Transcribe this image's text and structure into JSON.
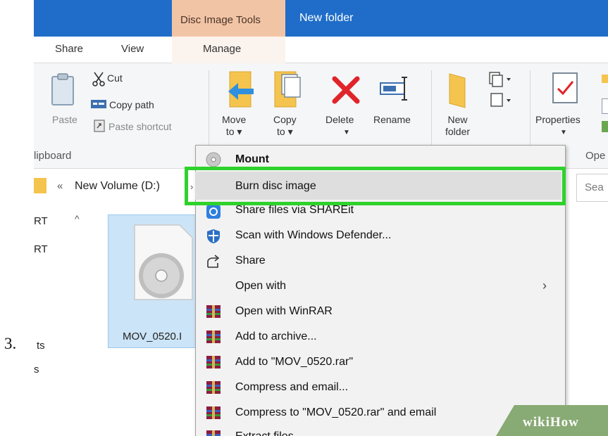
{
  "step_number": "3.",
  "window": {
    "contextual_tab": "Disc Image Tools",
    "title": "New folder"
  },
  "ribbon_tabs": {
    "share": "Share",
    "view": "View",
    "manage": "Manage"
  },
  "ribbon": {
    "paste": "Paste",
    "cut": "Cut",
    "copy_path": "Copy path",
    "paste_shortcut": "Paste shortcut",
    "move_to": {
      "line1": "Move",
      "line2": "to ▾"
    },
    "copy_to": {
      "line1": "Copy",
      "line2": "to ▾"
    },
    "delete": "Delete",
    "rename": "Rename",
    "new_folder": {
      "line1": "New",
      "line2": "folder"
    },
    "properties": "Properties",
    "group_clipboard": "lipboard",
    "group_open": "Ope"
  },
  "address": {
    "chevrons": "«",
    "path": "New Volume (D:)",
    "arrow": "›",
    "search_placeholder": "Sea"
  },
  "nav_pane": {
    "items": [
      "RT",
      "RT",
      "ts",
      "s"
    ],
    "scroll_up": "^"
  },
  "file": {
    "name": "MOV_0520.I"
  },
  "context_menu": {
    "items": [
      {
        "label": "Mount",
        "icon": "disc-icon",
        "bold": true
      },
      {
        "label": "Burn disc image",
        "icon": "",
        "highlighted": true
      },
      {
        "label": "Share files via SHAREit",
        "icon": "shareit-icon"
      },
      {
        "label": "Scan with Windows Defender...",
        "icon": "defender-shield-icon"
      },
      {
        "label": "Share",
        "icon": "share-icon"
      },
      {
        "label": "Open with",
        "icon": "",
        "submenu": true
      },
      {
        "label": "Open with WinRAR",
        "icon": "winrar-icon"
      },
      {
        "label": "Add to archive...",
        "icon": "winrar-icon"
      },
      {
        "label": "Add to \"MOV_0520.rar\"",
        "icon": "winrar-icon"
      },
      {
        "label": "Compress and email...",
        "icon": "winrar-icon"
      },
      {
        "label": "Compress to \"MOV_0520.rar\" and email",
        "icon": "winrar-icon"
      },
      {
        "label": "Extract files...",
        "icon": "winrar-icon"
      }
    ],
    "submenu_arrow": "›"
  },
  "watermark": "wikiHow",
  "colors": {
    "titlebar": "#1f6dc9",
    "contextual_tab": "#f2c4a6",
    "highlight_outline": "#2ed22b",
    "selection": "#cce4f7",
    "wikihow_green": "#85a870"
  }
}
